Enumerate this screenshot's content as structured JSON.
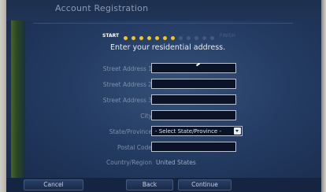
{
  "window": {
    "title": "Account Registration"
  },
  "progress": {
    "start_label": "START",
    "finish_label": "FINISH",
    "total_steps": 12,
    "completed_steps": 7
  },
  "instruction": "Enter your residential address.",
  "form": {
    "street1": {
      "label": "Street Address 1",
      "value": ""
    },
    "street2": {
      "label": "Street Address 2",
      "value": ""
    },
    "street3": {
      "label": "Street Address 3",
      "value": ""
    },
    "city": {
      "label": "City",
      "value": ""
    },
    "state": {
      "label": "State/Province",
      "selected": "- Select State/Province -"
    },
    "postal": {
      "label": "Postal Code",
      "value": ""
    },
    "country": {
      "label": "Country/Region",
      "value": "United States"
    }
  },
  "buttons": {
    "cancel": "Cancel",
    "back": "Back",
    "continue": "Continue"
  },
  "colors": {
    "progress_active": "#f5c41e",
    "progress_inactive": "#43597e",
    "background": "#243c63"
  }
}
